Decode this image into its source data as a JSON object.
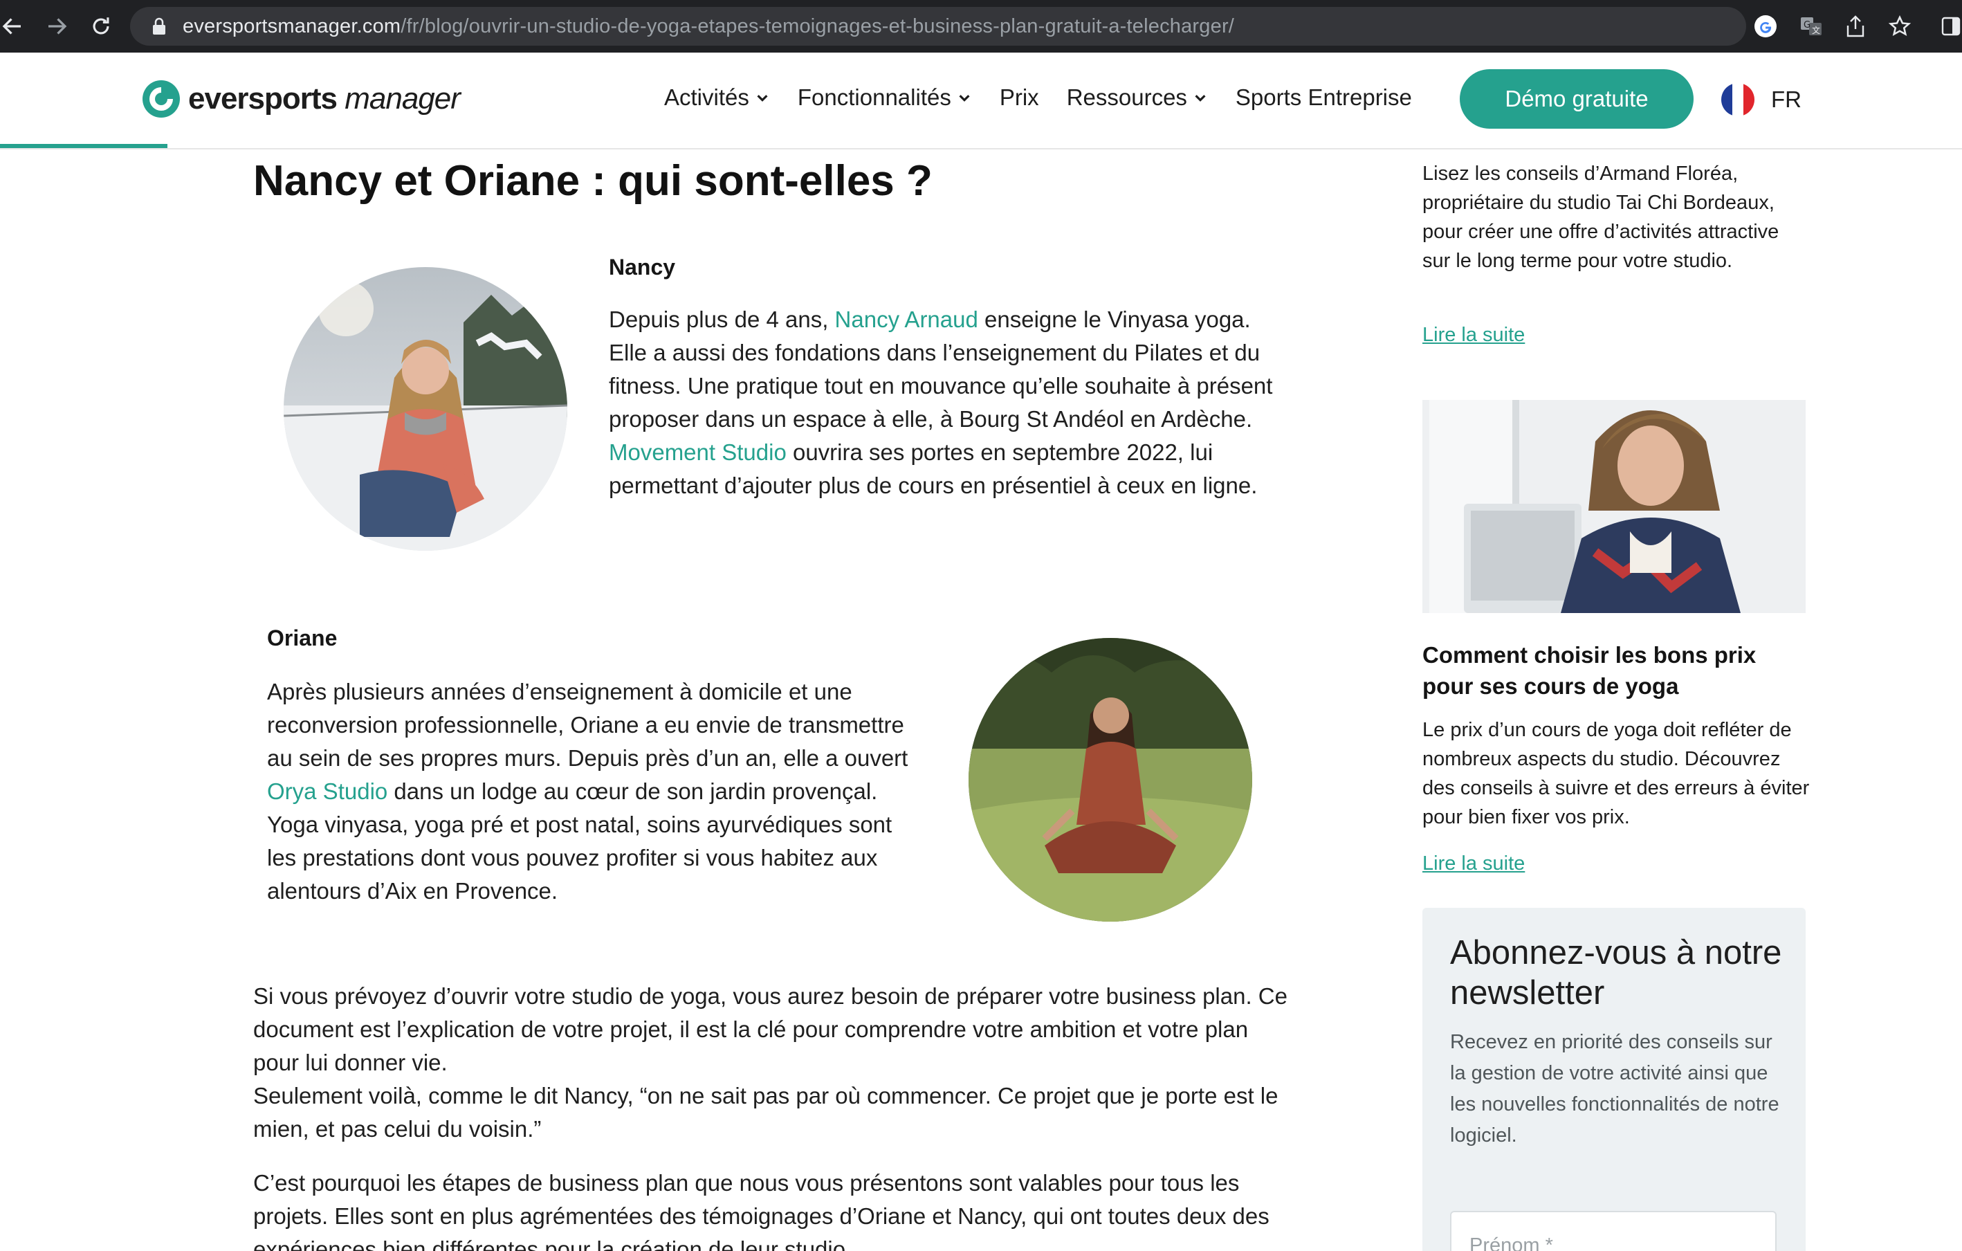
{
  "browser": {
    "url_host": "eversportsmanager.com",
    "url_path": "/fr/blog/ouvrir-un-studio-de-yoga-etapes-temoignages-et-business-plan-gratuit-a-telecharger/",
    "icons": [
      "back-icon",
      "forward-icon",
      "reload-icon",
      "lock-icon",
      "google-icon",
      "translate-icon",
      "share-icon",
      "star-icon",
      "sidebar-icon"
    ]
  },
  "header": {
    "logo_bold": "eversports",
    "logo_light": " manager",
    "nav": [
      {
        "label": "Activités",
        "dropdown": true
      },
      {
        "label": "Fonctionnalités",
        "dropdown": true
      },
      {
        "label": "Prix",
        "dropdown": false
      },
      {
        "label": "Ressources",
        "dropdown": true
      },
      {
        "label": "Sports Entreprise",
        "dropdown": false
      }
    ],
    "cta": "Démo gratuite",
    "lang": "FR",
    "accent": "#25a18e"
  },
  "article": {
    "heading": "Nancy et Oriane : qui sont-elles ?",
    "nancy": {
      "name": "Nancy",
      "p1": "Depuis plus de 4 ans, ",
      "link1": "Nancy Arnaud",
      "p2": " enseigne le Vinyasa yoga. Elle a aussi des fondations dans l’enseignement du Pilates et du fitness. Une pratique tout en mouvance qu’elle souhaite à présent proposer dans un espace à elle, à Bourg St Andéol en Ardèche. ",
      "link2": "Movement Studio",
      "p3": " ouvrira ses portes en septembre 2022, lui permettant d’ajouter plus de cours en présentiel à ceux en ligne."
    },
    "oriane": {
      "name": "Oriane",
      "p1": "Après plusieurs années d’enseignement à domicile et une reconversion professionnelle, Oriane a eu envie de transmettre au sein de ses propres murs. Depuis près d’un an, elle a ouvert ",
      "link1": "Orya Studio",
      "p2": " dans un lodge au cœur de son jardin provençal. Yoga vinyasa, yoga pré et post natal, soins ayurvédiques sont les prestations dont vous pouvez profiter si vous habitez aux alentours d’Aix en Provence."
    },
    "para1": "Si vous prévoyez d’ouvrir votre studio de yoga, vous aurez besoin de préparer votre business plan. Ce document est l’explication de votre projet, il est la clé pour comprendre votre ambition et votre plan pour lui donner vie.",
    "para2": "Seulement voilà, comme le dit Nancy, “on ne sait pas par où commencer. Ce projet que je porte est le mien, et pas celui du voisin.”",
    "para3": "C’est pourquoi les étapes de business plan que nous vous présentons sont valables pour tous les projets. Elles sont en plus agrémentées des témoignages d’Oriane et Nancy, qui ont toutes deux des expériences bien différentes pour la création de leur studio."
  },
  "sidebar": {
    "card1_text": "Lisez les conseils d’Armand Floréa, propriétaire du studio Tai Chi Bordeaux, pour créer une offre d’activités attractive sur le long terme pour votre studio.",
    "card1_link": "Lire la suite",
    "card2_title": "Comment choisir les bons prix pour ses cours de yoga",
    "card2_text": "Le prix d’un cours de yoga doit refléter de nombreux aspects du studio. Découvrez des conseils à suivre et des erreurs à éviter pour bien fixer vos prix.",
    "card2_link": "Lire la suite",
    "newsletter_title": "Abonnez-vous à notre newsletter",
    "newsletter_text": "Recevez en priorité des conseils sur la gestion de votre activité ainsi que les nouvelles fonctionnalités de notre logiciel.",
    "newsletter_placeholder": "Prénom *"
  }
}
